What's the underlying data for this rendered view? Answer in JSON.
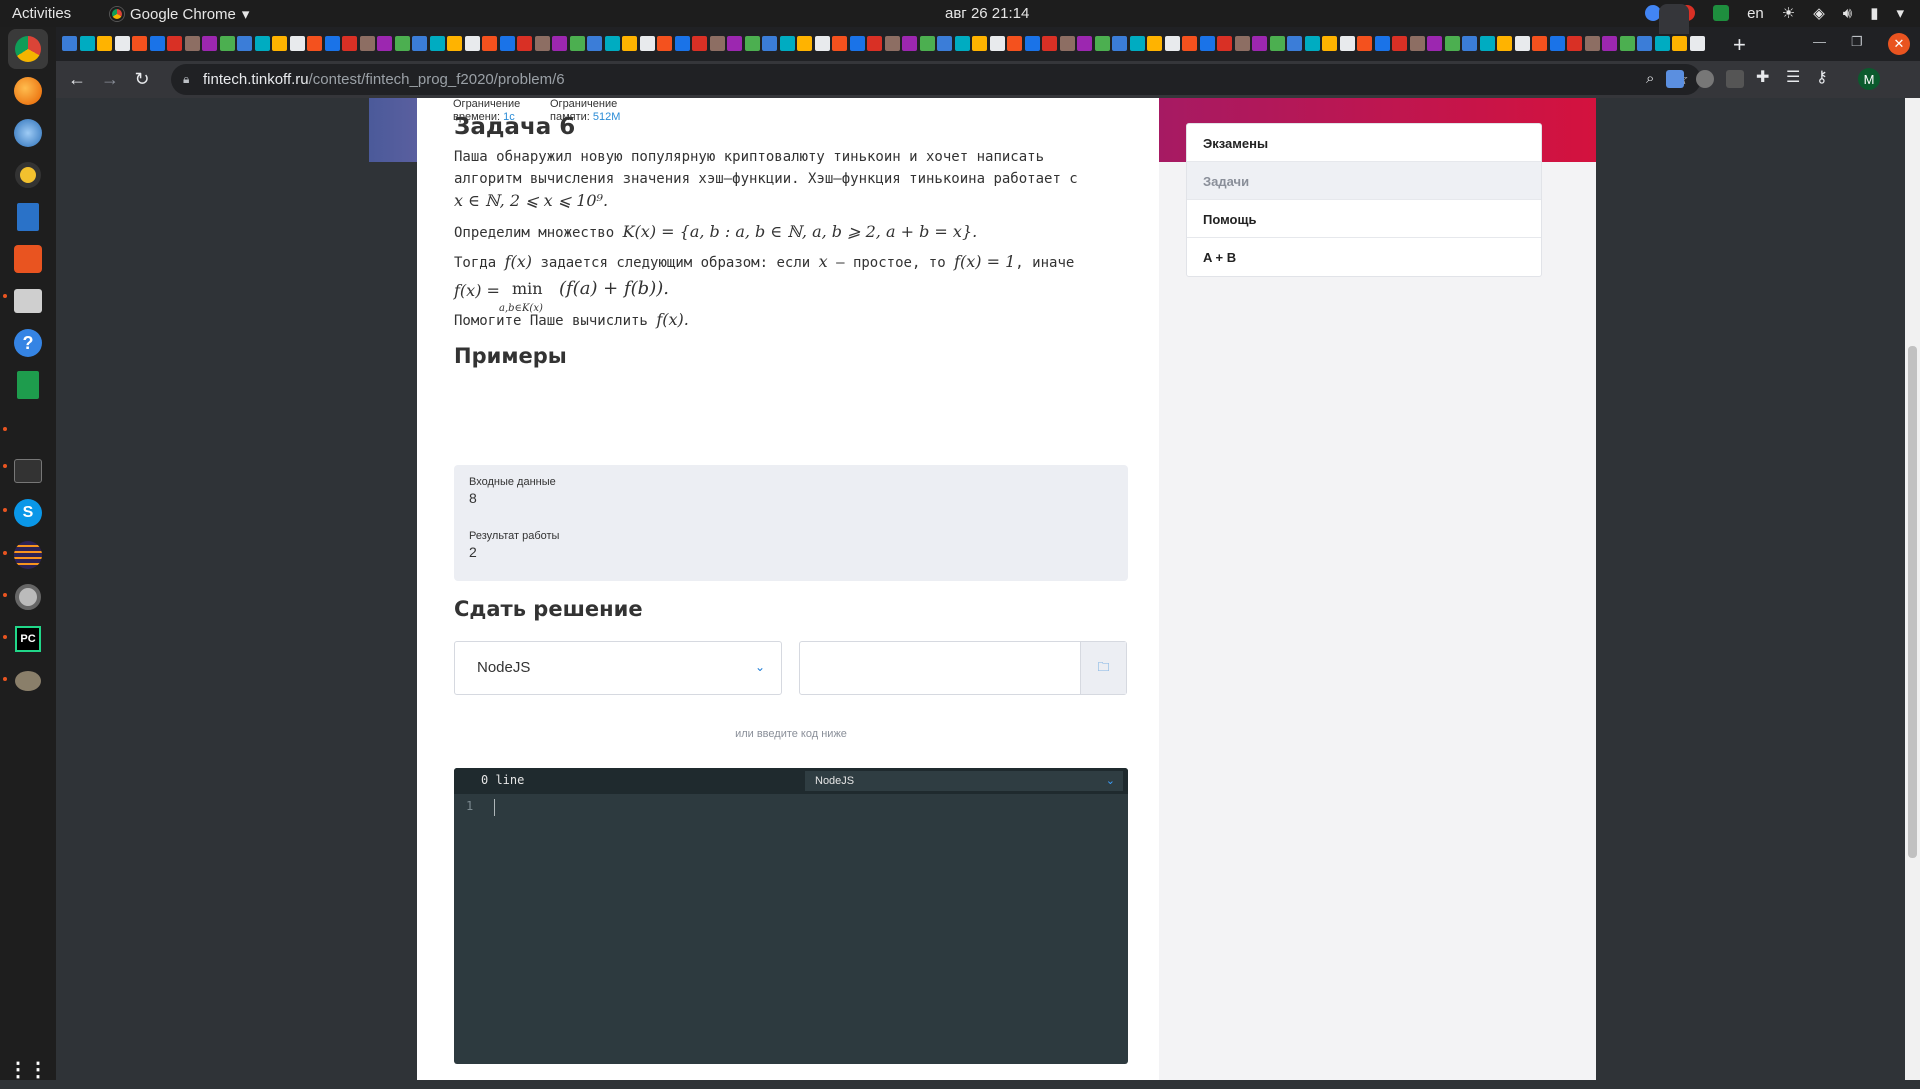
{
  "topbar": {
    "activities": "Activities",
    "app_name": "Google Chrome",
    "clock": "авг 26  21:14",
    "lang": "en"
  },
  "browser": {
    "url_host": "fintech.tinkoff.ru",
    "url_path": "/contest/fintech_prog_f2020/problem/6",
    "profile_initial": "M"
  },
  "limits": {
    "time_label_1": "Ограничение",
    "time_label_2": "времени:",
    "time_value": "1с",
    "memory_label_1": "Ограничение",
    "memory_label_2": "памяти:",
    "memory_value": "512M"
  },
  "problem": {
    "title": "Задача 6",
    "p1_line1": "Паша обнаружил новую популярную криптовалюту тинькоин и хочет написать",
    "p1_line2": "алгоритм вычисления значения хэш–функции. Хэш–функция тинькоина работает с",
    "p1_math": "x ∈ ℕ, 2 ⩽ x ⩽ 10⁹.",
    "p2_text": "Определим множество",
    "p2_math": "K(x) = {a, b : a, b ∈ ℕ, a, b ⩾ 2, a + b = x}.",
    "p3_prefix": "Тогда",
    "p3_fx": "f(x)",
    "p3_middle": "задается следующим образом: если",
    "p3_x": "x",
    "p3_prime": "– простое, то",
    "p3_cond": "f(x) = 1",
    "p3_else": ", иначе",
    "p3_formula_left": "f(x) =",
    "p3_formula_min": "min",
    "p3_formula_sub": "a,b∈K(x)",
    "p3_formula_right": "(f(a) + f(b)).",
    "help_text": "Помогите Паше вычислить",
    "help_math": "f(x)."
  },
  "examples": {
    "title": "Примеры",
    "input_label": "Входные данные",
    "input_value": "8",
    "output_label": "Результат работы",
    "output_value": "2"
  },
  "submit": {
    "title": "Сдать решение",
    "language": "NodeJS",
    "or_code": "или введите код ниже",
    "editor_lines": "0 line",
    "editor_mode": "NodeJS",
    "line_number": "1"
  },
  "sidebar": {
    "items": [
      {
        "label": "Экзамены"
      },
      {
        "label": "Задачи"
      },
      {
        "label": "Помощь"
      },
      {
        "label": "A + B"
      }
    ]
  }
}
